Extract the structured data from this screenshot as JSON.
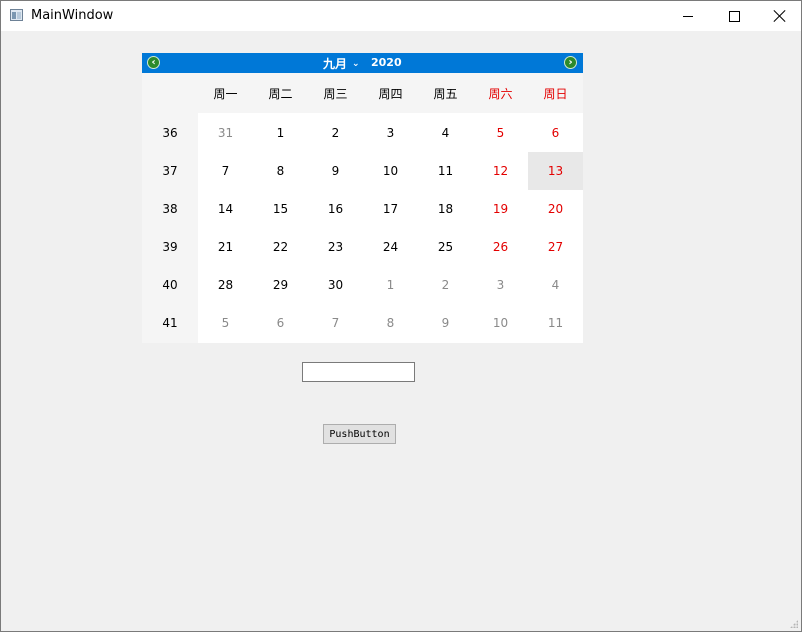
{
  "window": {
    "title": "MainWindow",
    "minimize_icon": "minimize-icon",
    "maximize_icon": "maximize-icon",
    "close_icon": "close-icon"
  },
  "calendar": {
    "month": "九月",
    "year": "2020",
    "prev_icon": "arrow-left-icon",
    "next_icon": "arrow-right-icon",
    "weekday_headers": [
      "周一",
      "周二",
      "周三",
      "周四",
      "周五",
      "周六",
      "周日"
    ],
    "week_numbers": [
      "36",
      "37",
      "38",
      "39",
      "40",
      "41"
    ],
    "weeks": [
      [
        "31",
        "1",
        "2",
        "3",
        "4",
        "5",
        "6"
      ],
      [
        "7",
        "8",
        "9",
        "10",
        "11",
        "12",
        "13"
      ],
      [
        "14",
        "15",
        "16",
        "17",
        "18",
        "19",
        "20"
      ],
      [
        "21",
        "22",
        "23",
        "24",
        "25",
        "26",
        "27"
      ],
      [
        "28",
        "29",
        "30",
        "1",
        "2",
        "3",
        "4"
      ],
      [
        "5",
        "6",
        "7",
        "8",
        "9",
        "10",
        "11"
      ]
    ],
    "selected_date": "13",
    "colors": {
      "nav_bar": "#0078d7",
      "weekend": "#e30000",
      "dim": "#8a8a8a",
      "selected": "#e8e8e8"
    }
  },
  "line_edit": {
    "value": ""
  },
  "push_button": {
    "label": "PushButton"
  }
}
